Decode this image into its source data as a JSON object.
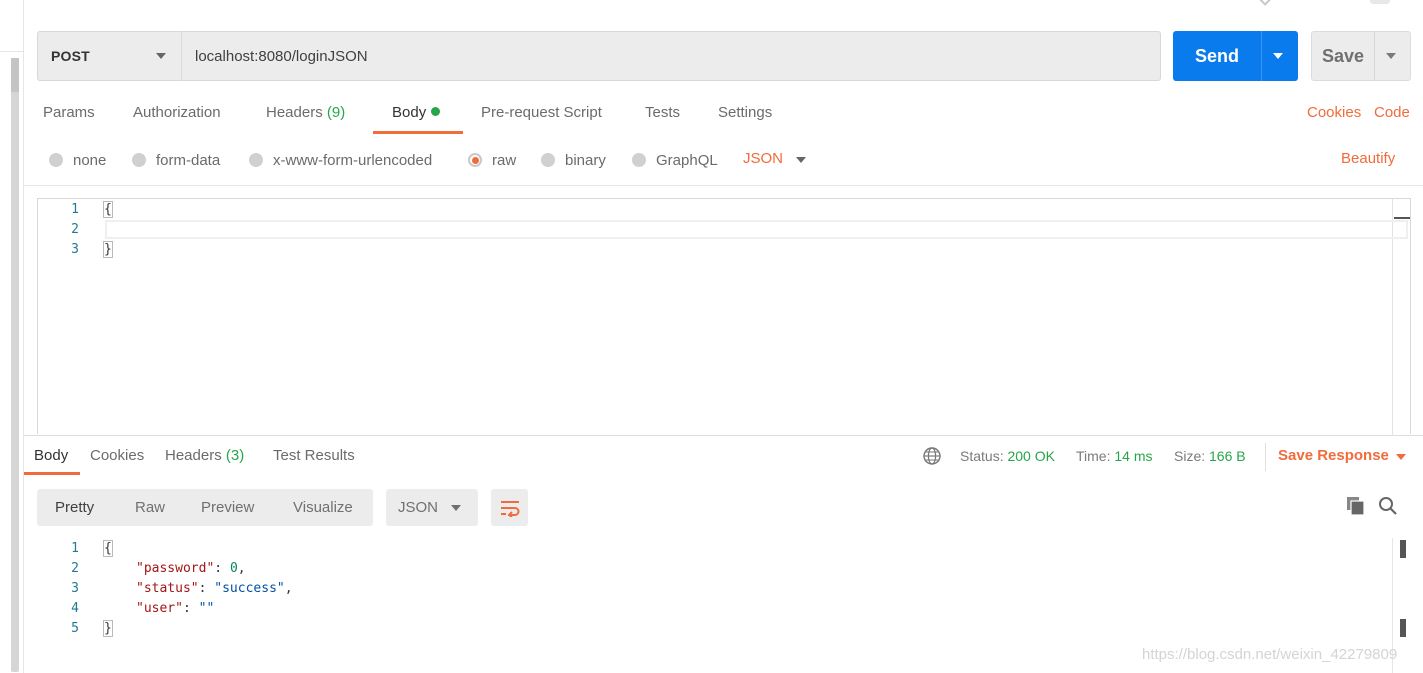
{
  "request": {
    "method": "POST",
    "url": "localhost:8080/loginJSON",
    "send_label": "Send",
    "save_label": "Save"
  },
  "request_tabs": {
    "params": "Params",
    "authorization": "Authorization",
    "headers": "Headers",
    "headers_count": "(9)",
    "body": "Body",
    "prerequest": "Pre-request Script",
    "tests": "Tests",
    "settings": "Settings",
    "cookies": "Cookies",
    "code": "Code",
    "active": "Body"
  },
  "body_types": {
    "none": "none",
    "form_data": "form-data",
    "urlencoded": "x-www-form-urlencoded",
    "raw": "raw",
    "binary": "binary",
    "graphql": "GraphQL",
    "selected": "raw",
    "format": "JSON",
    "beautify": "Beautify"
  },
  "request_body": {
    "line_numbers": [
      "1",
      "2",
      "3"
    ],
    "lines": [
      "{",
      "",
      "}"
    ]
  },
  "response_tabs": {
    "body": "Body",
    "cookies": "Cookies",
    "headers": "Headers",
    "headers_count": "(3)",
    "test_results": "Test Results",
    "active": "Body"
  },
  "response_status": {
    "status_label": "Status:",
    "status_value": "200 OK",
    "time_label": "Time:",
    "time_value": "14 ms",
    "size_label": "Size:",
    "size_value": "166 B",
    "save_response": "Save Response"
  },
  "view_tabs": {
    "pretty": "Pretty",
    "raw": "Raw",
    "preview": "Preview",
    "visualize": "Visualize",
    "active": "Pretty",
    "format": "JSON"
  },
  "response_body": {
    "line_numbers": [
      "1",
      "2",
      "3",
      "4",
      "5"
    ],
    "open": "{",
    "close": "}",
    "fields": [
      {
        "key": "\"password\"",
        "value": "0",
        "kind": "number",
        "trail": ","
      },
      {
        "key": "\"status\"",
        "value": "\"success\"",
        "kind": "string",
        "trail": ","
      },
      {
        "key": "\"user\"",
        "value": "\"\"",
        "kind": "string",
        "trail": ""
      }
    ]
  },
  "watermark": "https://blog.csdn.net/weixin_42279809",
  "colors": {
    "accent_orange": "#f26b3a",
    "send_blue": "#097bed",
    "ok_green": "#26a64a"
  }
}
